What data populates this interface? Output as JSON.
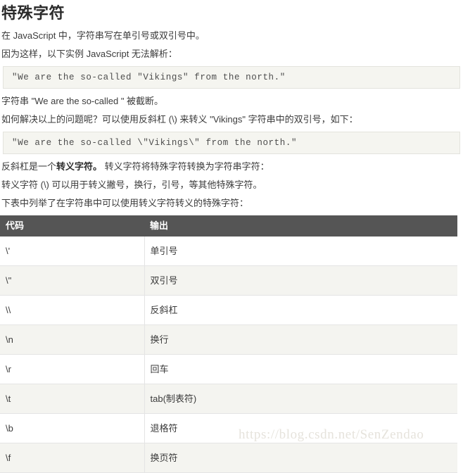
{
  "page": {
    "title": "特殊字符",
    "paragraphs": [
      "在 JavaScript 中，字符串写在单引号或双引号中。",
      "因为这样，以下实例 JavaScript 无法解析：",
      "字符串 \"We are the so-called \" 被截断。",
      "如何解决以上的问题呢？可以使用反斜杠 (\\) 来转义 \"Vikings\" 字符串中的双引号，如下：",
      "转义字符 (\\) 可以用于转义撇号，换行，引号，等其他特殊字符。",
      "下表中列举了在字符串中可以使用转义字符转义的特殊字符："
    ],
    "escape_sentence": {
      "prefix": "反斜杠是一个",
      "bold": "转义字符。",
      "suffix": " 转义字符将特殊字符转换为字符串字符："
    },
    "code_blocks": [
      "\"We are the so-called \"Vikings\" from the north.\"",
      "\"We are the so-called \\\"Vikings\\\" from the north.\""
    ]
  },
  "table": {
    "headers": [
      "代码",
      "输出"
    ],
    "rows": [
      {
        "code": "\\'",
        "output": "单引号"
      },
      {
        "code": "\\\"",
        "output": "双引号"
      },
      {
        "code": "\\\\",
        "output": "反斜杠"
      },
      {
        "code": "\\n",
        "output": "换行"
      },
      {
        "code": "\\r",
        "output": "回车"
      },
      {
        "code": "\\t",
        "output": "tab(制表符)"
      },
      {
        "code": "\\b",
        "output": "退格符"
      },
      {
        "code": "\\f",
        "output": "换页符"
      }
    ]
  },
  "watermark": {
    "text": "https://blog.csdn.net/SenZendao"
  },
  "colors": {
    "table_header_bg": "#555555",
    "table_header_text": "#ffffff",
    "row_alt_bg": "#f4f4f0",
    "code_block_bg": "#f5f5f0",
    "code_block_border": "#e3e3dd",
    "body_text": "#3b3b3b",
    "watermark": "#e6e3dc"
  }
}
